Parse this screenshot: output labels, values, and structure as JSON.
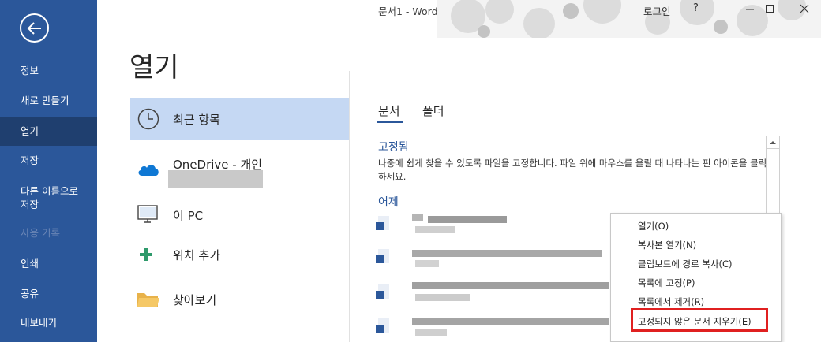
{
  "window": {
    "title": "문서1  -  Word",
    "login": "로그인",
    "help": "?"
  },
  "nav": {
    "items": [
      {
        "label": "정보",
        "active": false,
        "disabled": false
      },
      {
        "label": "새로 만들기",
        "active": false,
        "disabled": false
      },
      {
        "label": "열기",
        "active": true,
        "disabled": false
      },
      {
        "label": "저장",
        "active": false,
        "disabled": false
      },
      {
        "label": "다른 이름으로",
        "label2": "저장",
        "active": false,
        "disabled": false
      },
      {
        "label": "사용 기록",
        "active": false,
        "disabled": true
      },
      {
        "label": "인쇄",
        "active": false,
        "disabled": false
      },
      {
        "label": "공유",
        "active": false,
        "disabled": false
      },
      {
        "label": "내보내기",
        "active": false,
        "disabled": false
      }
    ]
  },
  "page": {
    "title": "열기"
  },
  "locations": [
    {
      "label": "최근 항목",
      "icon": "clock-icon",
      "selected": true
    },
    {
      "label": "OneDrive - 개인",
      "icon": "onedrive-cloud-icon",
      "selected": false
    },
    {
      "label": "이 PC",
      "icon": "computer-icon",
      "selected": false
    },
    {
      "label": "위치 추가",
      "icon": "plus-icon",
      "selected": false
    },
    {
      "label": "찾아보기",
      "icon": "folder-icon",
      "selected": false
    }
  ],
  "tabs": {
    "documents": "문서",
    "folders": "폴더"
  },
  "pinned": {
    "heading": "고정됨",
    "description": "나중에 쉽게 찾을 수 있도록 파일을 고정합니다. 파일 위에 마우스를 올릴 때 나타나는 핀 아이콘을 클릭하세요."
  },
  "yesterday": {
    "heading": "어제"
  },
  "context_menu": {
    "items": [
      {
        "label": "열기(O)"
      },
      {
        "label": "복사본 열기(N)"
      },
      {
        "label": "클립보드에 경로 복사(C)"
      },
      {
        "label": "목록에 고정(P)"
      },
      {
        "label": "목록에서 제거(R)"
      },
      {
        "label": "고정되지 않은 문서 지우기(E)",
        "highlighted": true
      }
    ]
  },
  "colors": {
    "nav_bg": "#2b579a",
    "nav_active": "#1f3f6f",
    "accent": "#2b579a",
    "selected_location": "#c5d8f3",
    "highlight_border": "#e02020"
  }
}
